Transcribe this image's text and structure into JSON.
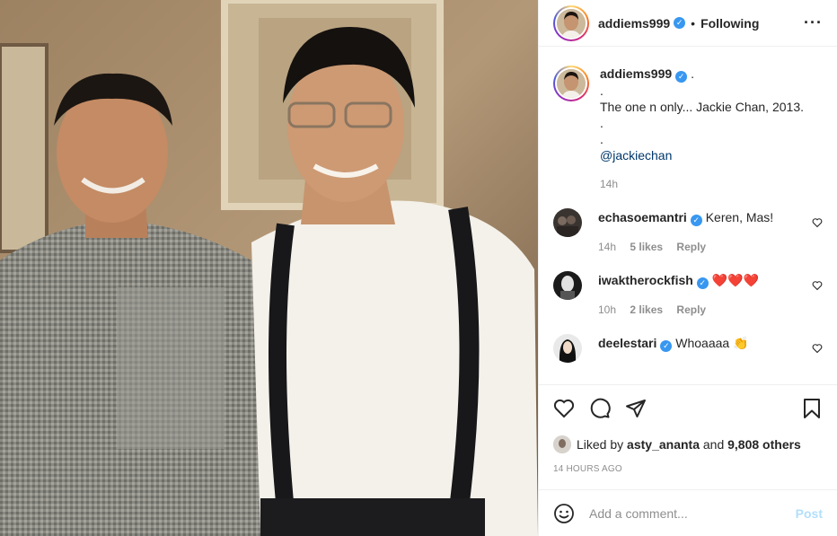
{
  "header": {
    "username": "addiems999",
    "separator": "•",
    "follow_status": "Following",
    "more_icon": "more-horizontal-icon"
  },
  "caption": {
    "username": "addiems999",
    "lines": [
      ".",
      ".",
      "The one n only... Jackie Chan, 2013.",
      ".",
      ".",
      "@jackiechan"
    ],
    "time": "14h"
  },
  "comments": [
    {
      "username": "echasoemantri",
      "text": "Keren, Mas!",
      "time": "14h",
      "likes": "5 likes",
      "reply": "Reply"
    },
    {
      "username": "iwaktherockfish",
      "text": "❤️❤️❤️",
      "time": "10h",
      "likes": "2 likes",
      "reply": "Reply"
    },
    {
      "username": "deelestari",
      "text": "Whoaaaa 👏",
      "time": "",
      "likes": "",
      "reply": ""
    }
  ],
  "actions": {
    "like_icon": "heart-icon",
    "comment_icon": "comment-icon",
    "share_icon": "paper-plane-icon",
    "save_icon": "bookmark-icon",
    "liked_prefix": "Liked by",
    "liked_user": "asty_ananta",
    "liked_and": "and",
    "liked_count": "9,808 others",
    "timestamp": "14 HOURS AGO"
  },
  "add_comment": {
    "placeholder": "Add a comment...",
    "post_label": "Post",
    "emoji_icon": "smiley-icon"
  },
  "colors": {
    "verified": "#3897f0",
    "link": "#00376b",
    "muted": "#8e8e8e",
    "post_disabled": "#b2dffc",
    "heart_red": "#ed4956"
  }
}
